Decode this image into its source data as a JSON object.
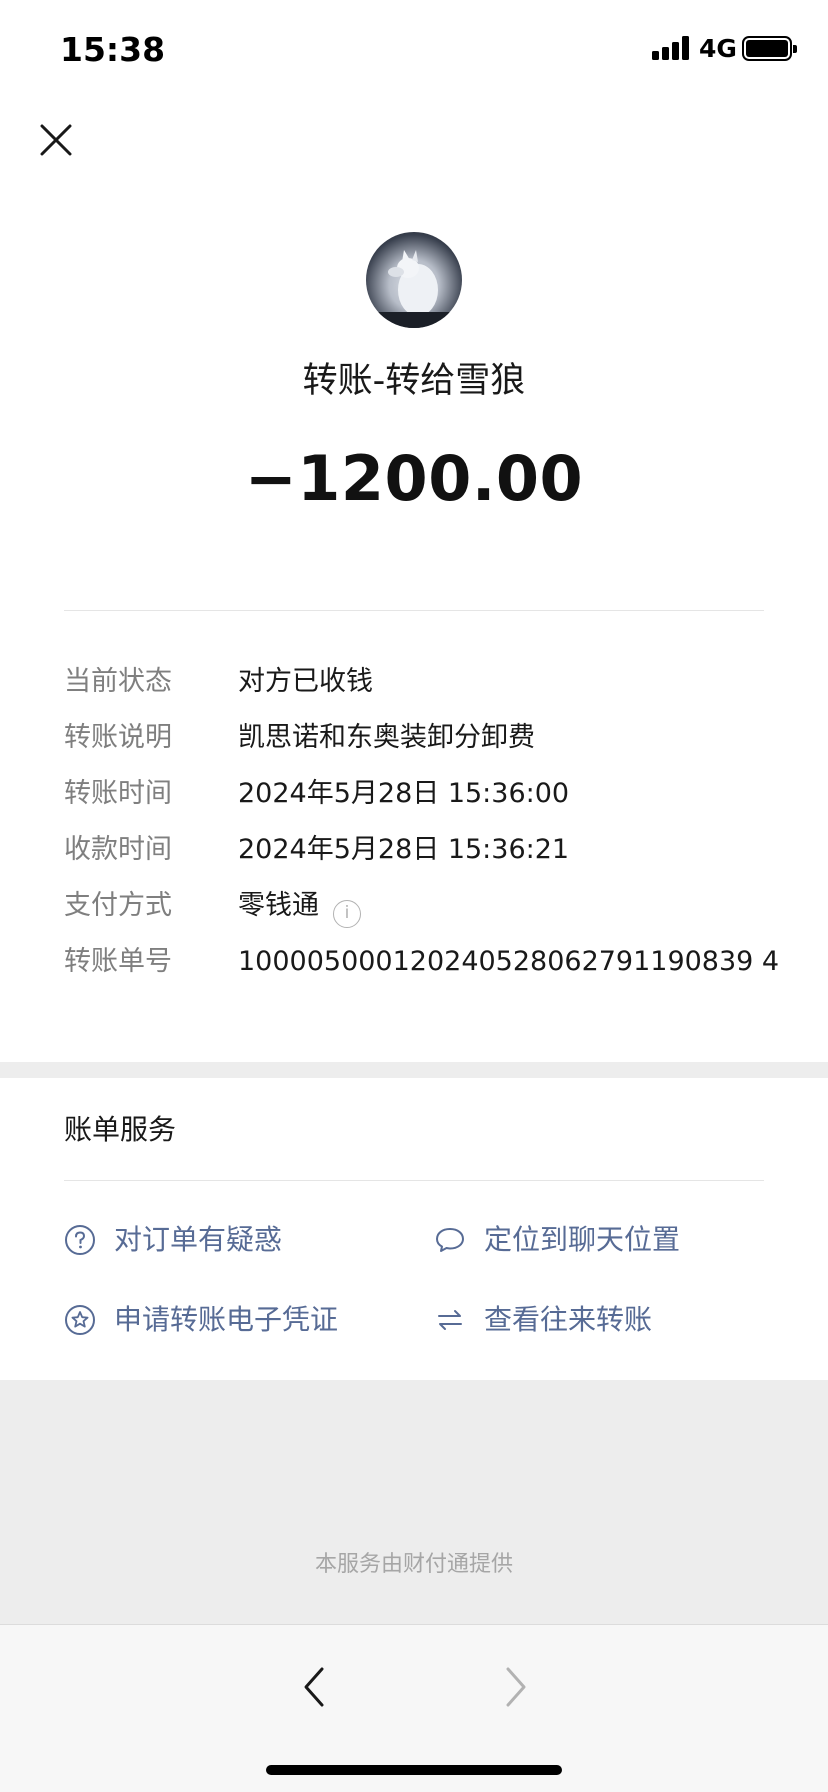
{
  "status_bar": {
    "time": "15:38",
    "network": "4G"
  },
  "header": {
    "close_icon": "close-icon"
  },
  "transfer": {
    "avatar_icon": "wolf-avatar",
    "title": "转账-转给雪狼",
    "amount": "−1200.00"
  },
  "details": [
    {
      "label": "当前状态",
      "value": "对方已收钱"
    },
    {
      "label": "转账说明",
      "value": "凯思诺和东奥装卸分卸费"
    },
    {
      "label": "转账时间",
      "value": "2024年5月28日 15:36:00"
    },
    {
      "label": "收款时间",
      "value": "2024年5月28日 15:36:21"
    },
    {
      "label": "支付方式",
      "value": "零钱通",
      "icon": "info-icon",
      "icon_glyph": "i"
    },
    {
      "label": "转账单号",
      "value": "100005000120240528062791190839 4"
    }
  ],
  "services": {
    "title": "账单服务",
    "items": [
      {
        "label": "对订单有疑惑",
        "icon": "question-circle-icon"
      },
      {
        "label": "定位到聊天位置",
        "icon": "chat-bubble-icon"
      },
      {
        "label": "申请转账电子凭证",
        "icon": "star-circle-icon"
      },
      {
        "label": "查看往来转账",
        "icon": "transfer-arrows-icon"
      }
    ]
  },
  "footer": {
    "text": "本服务由财付通提供"
  },
  "browser_nav": {
    "back_icon": "chevron-left-icon",
    "forward_icon": "chevron-right-icon"
  },
  "colors": {
    "link": "#576b95",
    "label_gray": "#7f7f7f",
    "background": "#ededed"
  }
}
